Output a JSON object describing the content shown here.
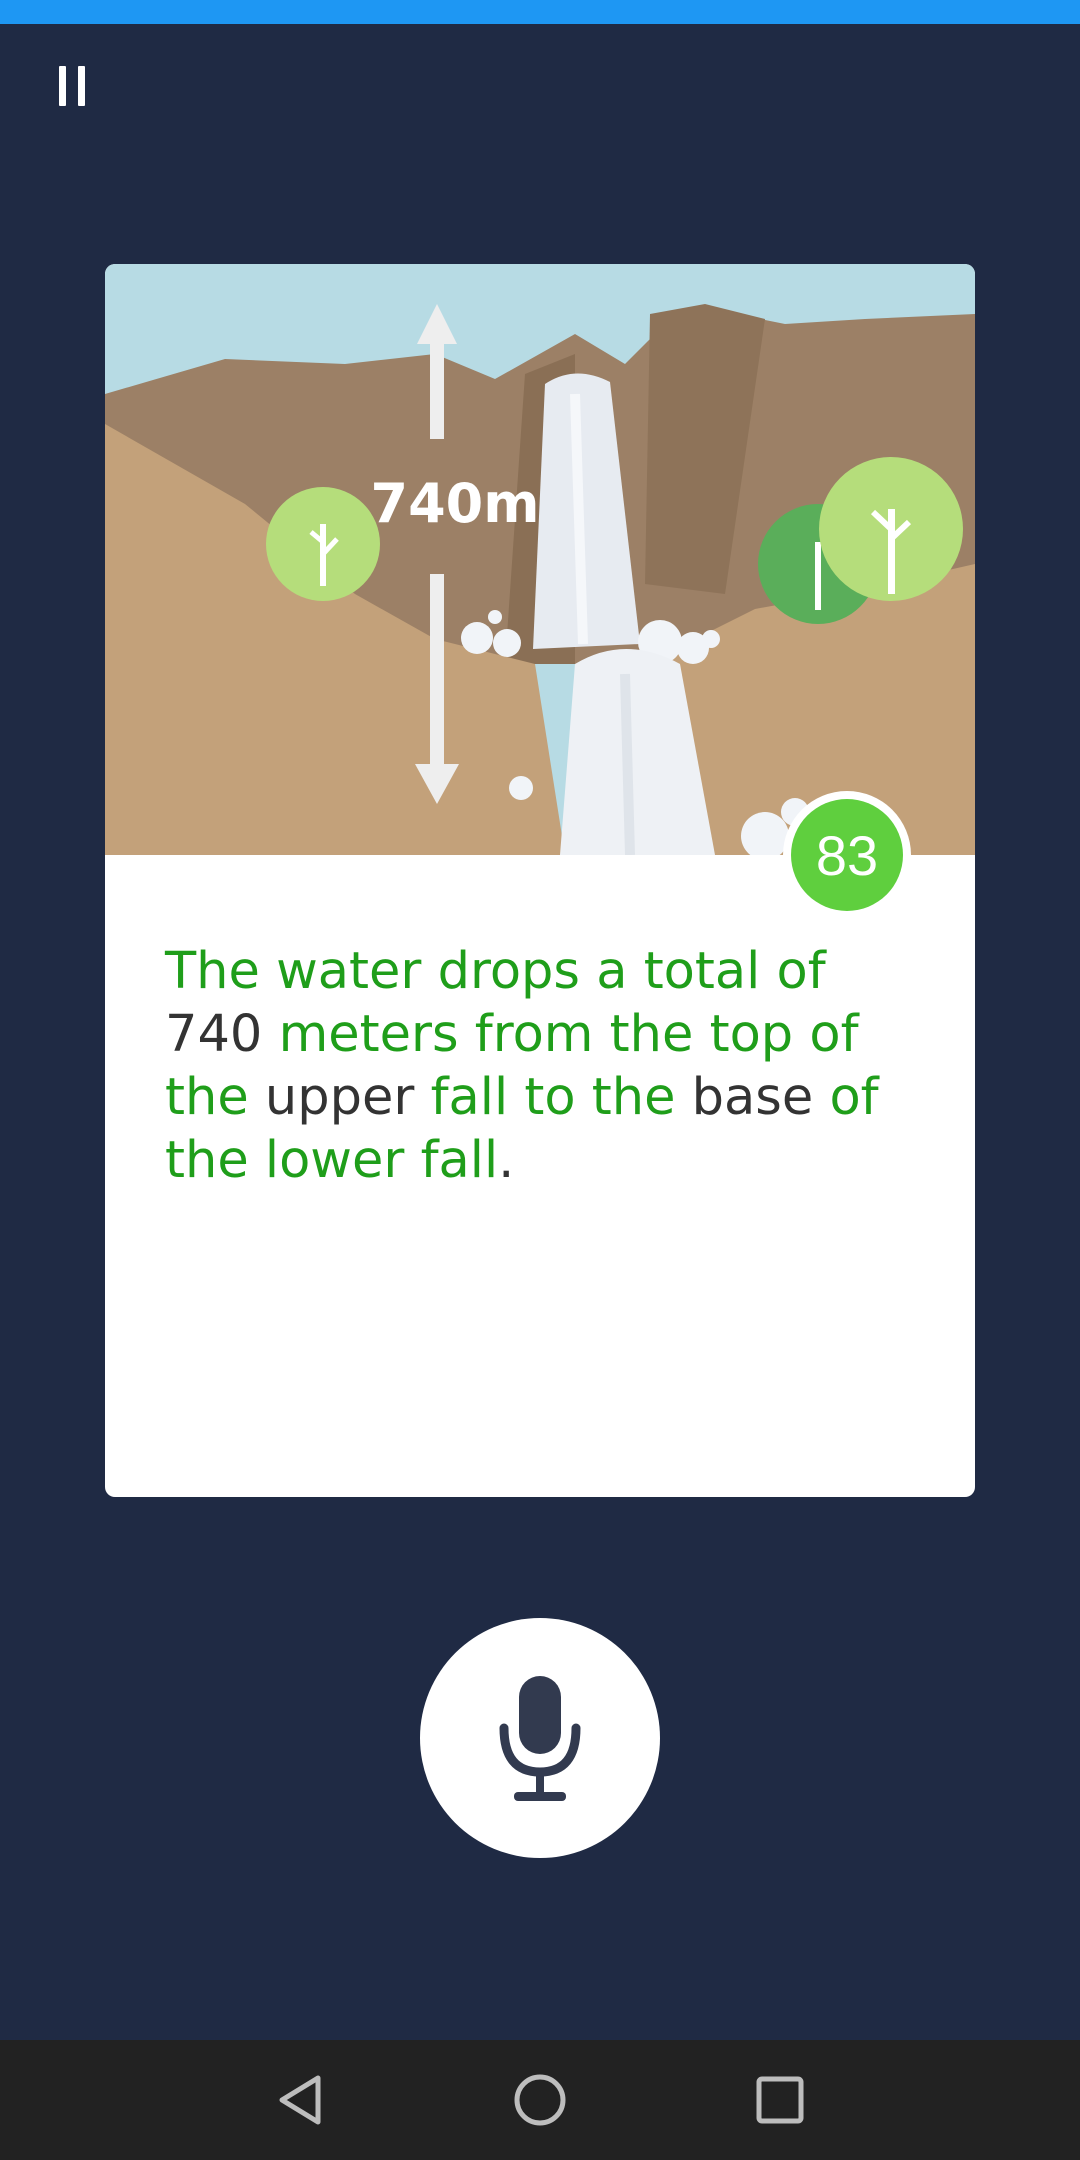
{
  "app": {
    "background_color": "#1f2a44",
    "status_bar_color": "#1e97f3"
  },
  "header": {
    "pause_icon": "pause-icon"
  },
  "card": {
    "illustration": {
      "label": "740m",
      "subject": "waterfall"
    },
    "score": "83",
    "score_color": "#5fcf3e",
    "sentence_words": [
      {
        "text": "The",
        "status": "ok"
      },
      {
        "text": " ",
        "status": "space"
      },
      {
        "text": "water",
        "status": "ok"
      },
      {
        "text": " ",
        "status": "space"
      },
      {
        "text": "drops",
        "status": "ok"
      },
      {
        "text": " ",
        "status": "space"
      },
      {
        "text": "a",
        "status": "ok"
      },
      {
        "text": " ",
        "status": "space"
      },
      {
        "text": "total",
        "status": "ok"
      },
      {
        "text": " ",
        "status": "space"
      },
      {
        "text": "of",
        "status": "ok"
      },
      {
        "text": " ",
        "status": "space"
      },
      {
        "text": "740",
        "status": "plain"
      },
      {
        "text": " ",
        "status": "space"
      },
      {
        "text": "meters",
        "status": "ok"
      },
      {
        "text": " ",
        "status": "space"
      },
      {
        "text": "from",
        "status": "ok"
      },
      {
        "text": " ",
        "status": "space"
      },
      {
        "text": "the",
        "status": "ok"
      },
      {
        "text": " ",
        "status": "space"
      },
      {
        "text": "top",
        "status": "ok"
      },
      {
        "text": " ",
        "status": "space"
      },
      {
        "text": "of",
        "status": "ok"
      },
      {
        "text": " ",
        "status": "space"
      },
      {
        "text": "the",
        "status": "ok"
      },
      {
        "text": " ",
        "status": "space"
      },
      {
        "text": "upper",
        "status": "plain"
      },
      {
        "text": " ",
        "status": "space"
      },
      {
        "text": "fall",
        "status": "ok"
      },
      {
        "text": " ",
        "status": "space"
      },
      {
        "text": "to",
        "status": "ok"
      },
      {
        "text": " ",
        "status": "space"
      },
      {
        "text": "the",
        "status": "ok"
      },
      {
        "text": " ",
        "status": "space"
      },
      {
        "text": "base",
        "status": "plain"
      },
      {
        "text": " ",
        "status": "space"
      },
      {
        "text": "of",
        "status": "ok"
      },
      {
        "text": " ",
        "status": "space"
      },
      {
        "text": "the",
        "status": "ok"
      },
      {
        "text": " ",
        "status": "space"
      },
      {
        "text": "lower",
        "status": "ok"
      },
      {
        "text": " ",
        "status": "space"
      },
      {
        "text": "fall",
        "status": "ok"
      },
      {
        "text": ".",
        "status": "plain"
      }
    ],
    "correct_color": "#1f9e1a",
    "plain_color": "#333333"
  },
  "controls": {
    "mic_icon": "microphone-icon"
  },
  "nav": {
    "back_icon": "back-triangle-icon",
    "home_icon": "home-circle-icon",
    "recents_icon": "recents-square-icon"
  }
}
